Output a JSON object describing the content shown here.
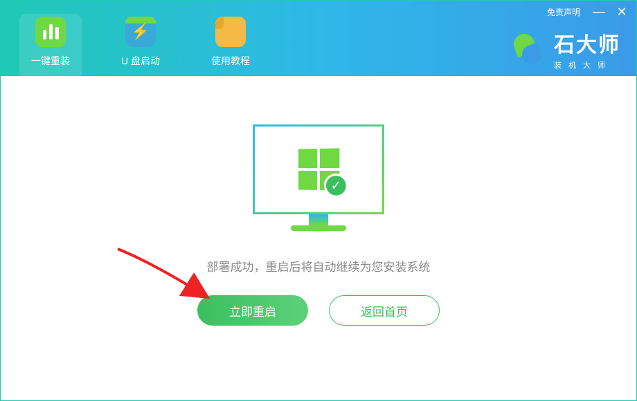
{
  "header": {
    "tabs": [
      {
        "label": "一键重装"
      },
      {
        "label": "U 盘启动"
      },
      {
        "label": "使用教程"
      }
    ],
    "disclaimer": "免责声明",
    "logo": {
      "title": "石大师",
      "subtitle": "装机大师"
    }
  },
  "main": {
    "status_text": "部署成功，重启后将自动继续为您安装系统",
    "primary_label": "立即重启",
    "secondary_label": "返回首页"
  }
}
